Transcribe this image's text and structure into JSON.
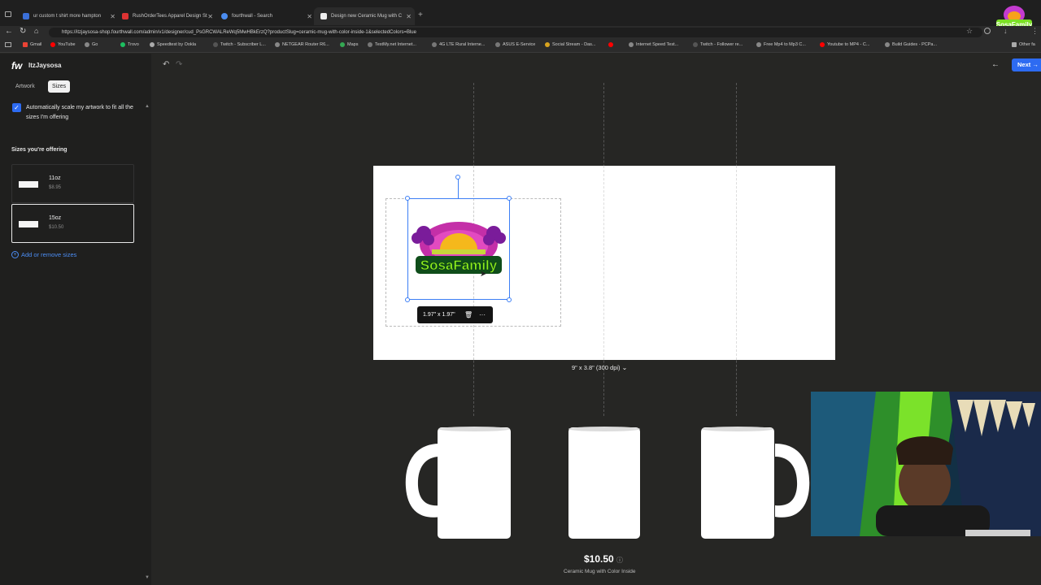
{
  "browser": {
    "tabs": [
      {
        "title": "ur custom t shirt more hampton"
      },
      {
        "title": "RushOrderTees Apparel Design St"
      },
      {
        "title": "fourthwall - Search"
      },
      {
        "title": "Design new Ceramic Mug with C"
      }
    ],
    "url": "https://itzjaysosa-shop.fourthwall.com/admin/v1/designer/cud_PsGRCWALReWq5MwHBkErzQ?productSlug=ceramic-mug-with-color-inside-1&selectedColors=Blue",
    "bookmarks": [
      "Gmail",
      "YouTube",
      "Go",
      "Trovo",
      "Speedtest by Ookla",
      "Twitch - Subscriber L...",
      "NETGEAR Router R6...",
      "Maps",
      "TestMy.net Internet...",
      "4G LTE Rural Interne...",
      "ASUS E-Service",
      "Social Stream - Das...",
      "Internet Speed Test...",
      "Twitch - Follower re...",
      "Free Mp4 to Mp3 C...",
      "Youtube to MP4 - C...",
      "Build Guides - PCPa...",
      "Other fa"
    ]
  },
  "sidebar": {
    "brand_logo": "fw",
    "shop_name": "ItzJaysosa",
    "tabs": [
      "Artwork",
      "Sizes"
    ],
    "active_tab": "Sizes",
    "autoscale_label": "Automatically scale my artwork to fit all the sizes I'm offering",
    "autoscale_checked": true,
    "sizes_heading": "Sizes you're offering",
    "sizes": [
      {
        "name": "11oz",
        "price": "$8.95",
        "selected": false
      },
      {
        "name": "15oz",
        "price": "$10.50",
        "selected": true
      }
    ],
    "add_sizes_label": "Add or remove sizes"
  },
  "toolbar": {
    "next_label": "Next"
  },
  "canvas": {
    "dimension_label": "1.97\" x 1.97\"",
    "print_size_label": "9\" x 3.8\" (300 dpi)",
    "logo_text": "SosaFamily"
  },
  "product": {
    "price": "$10.50",
    "name": "Ceramic Mug with Color Inside"
  },
  "colors": {
    "accent": "#2d6bf2",
    "selection": "#3d7ff5",
    "background": "#262624"
  }
}
